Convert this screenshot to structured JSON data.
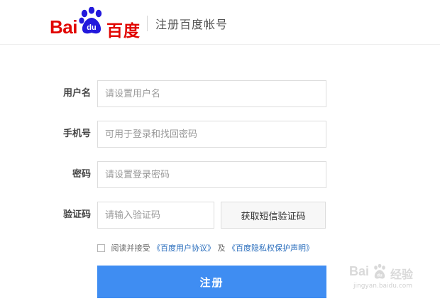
{
  "header": {
    "logo_bai": "Bai",
    "logo_du": "du",
    "logo_cn": "百度",
    "title": "注册百度帐号",
    "brand_color": "#e10602"
  },
  "form": {
    "username": {
      "label": "用户名",
      "placeholder": "请设置用户名",
      "value": ""
    },
    "phone": {
      "label": "手机号",
      "placeholder": "可用于登录和找回密码",
      "value": ""
    },
    "password": {
      "label": "密码",
      "placeholder": "请设置登录密码",
      "value": ""
    },
    "captcha": {
      "label": "验证码",
      "placeholder": "请输入验证码",
      "value": "",
      "button": "获取短信验证码"
    }
  },
  "agreement": {
    "prefix": "阅读并接受",
    "link1": "《百度用户协议》",
    "middle": "及",
    "link2": "《百度隐私权保护声明》",
    "checked": false
  },
  "submit_label": "注册",
  "accent_color": "#3f8df2",
  "watermark": {
    "logo": "Bai",
    "du": "du",
    "text": "经验",
    "url": "jingyan.baidu.com"
  }
}
